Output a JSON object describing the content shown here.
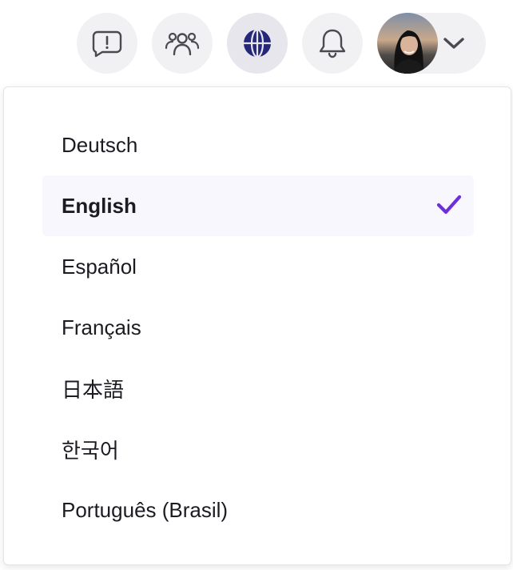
{
  "toolbar": {
    "buttons": [
      {
        "name": "feedback",
        "icon": "feedback-bubble-icon"
      },
      {
        "name": "people",
        "icon": "people-icon"
      },
      {
        "name": "language",
        "icon": "globe-icon",
        "active": true
      },
      {
        "name": "notifications",
        "icon": "bell-icon"
      }
    ],
    "account": {
      "avatar": "user-avatar",
      "icon": "chevron-down-icon"
    }
  },
  "language_menu": {
    "items": [
      {
        "label": "Deutsch",
        "selected": false
      },
      {
        "label": "English",
        "selected": true
      },
      {
        "label": "Español",
        "selected": false
      },
      {
        "label": "Français",
        "selected": false
      },
      {
        "label": "日本語",
        "selected": false
      },
      {
        "label": "한국어",
        "selected": false
      },
      {
        "label": "Português (Brasil)",
        "selected": false
      }
    ],
    "check_icon": "checkmark-icon"
  },
  "colors": {
    "accent": "#6d2fdc",
    "globe_fill": "#25277a",
    "icon_stroke": "#4a4a50",
    "button_bg": "#f1f1f3",
    "selected_bg": "#f8f7fd",
    "text": "#1c1b22"
  }
}
